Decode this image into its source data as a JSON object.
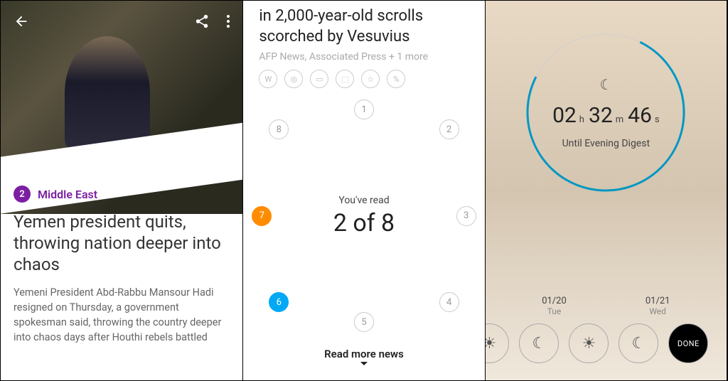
{
  "article": {
    "badge_num": "2",
    "category": "Middle East",
    "headline": "Yemen president quits, throwing nation deeper into chaos",
    "summary": "Yemeni President Abd-Rabbu Mansour Hadi resigned on Thursday, a government spokesman said, throwing the country deeper into chaos days after Houthi rebels battled"
  },
  "progress": {
    "title": "in 2,000-year-old scrolls scorched by Vesuvius",
    "source": "AFP News, Associated Press + 1 more",
    "icons": [
      "W",
      "◎",
      "▭",
      "⬚",
      "☆",
      "%"
    ],
    "read_label": "You've read",
    "read_count": "2 of 8",
    "nodes": [
      "1",
      "2",
      "3",
      "4",
      "5",
      "6",
      "7",
      "8"
    ],
    "readmore": "Read more news"
  },
  "timer": {
    "h": "02",
    "m": "32",
    "s": "46",
    "hu": "h",
    "mu": "m",
    "su": "s",
    "until": "Until Evening Digest",
    "dates": [
      {
        "date": "01/20",
        "day": "Tue"
      },
      {
        "date": "01/21",
        "day": "Wed"
      }
    ],
    "done": "DONE"
  },
  "colors": {
    "purple": "#7B1FA2",
    "orange": "#FF8C00",
    "blue": "#03A9F4",
    "arc": "#0097C4"
  }
}
